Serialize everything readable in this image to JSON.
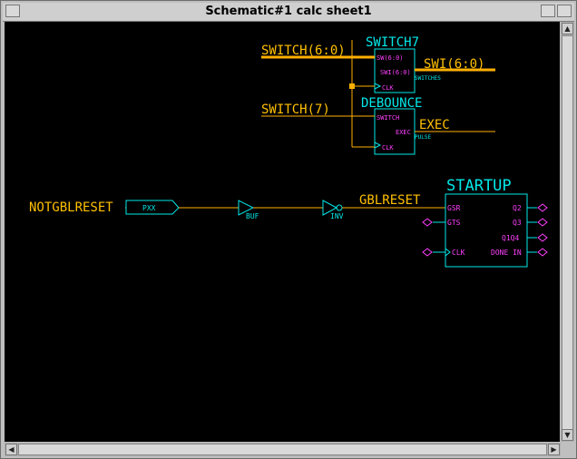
{
  "window": {
    "title": "Schematic#1 calc sheet1"
  },
  "nets": {
    "switch_bus": "SWITCH(6:0)",
    "switch7": "SWITCH(7)",
    "swi_bus": "SWI(6:0)",
    "exec": "EXEC",
    "notglbreset": "NOTGBLRESET",
    "glbreset": "GBLRESET"
  },
  "components": {
    "switch7": {
      "name": "SWITCH7",
      "pin_in": "SW(6:0)",
      "pin_out": "SWI(6:0)",
      "pin_clk": "CLK",
      "pin_sub": "SWITCHES"
    },
    "debounce": {
      "name": "DEBOUNCE",
      "pin_in": "SWITCH",
      "pin_out": "EXEC",
      "pin_clk": "CLK",
      "pin_sub": "PULSE"
    },
    "pad": {
      "label": "PXX"
    },
    "buf": {
      "label": "BUF"
    },
    "inv": {
      "label": "INV"
    },
    "startup": {
      "name": "STARTUP",
      "pins": {
        "gsr": "GSR",
        "gts": "GTS",
        "clk": "CLK",
        "q2": "Q2",
        "q3": "Q3",
        "q1q4": "Q1Q4",
        "done_in": "DONE IN"
      }
    }
  },
  "colors": {
    "wire": "#ffb000",
    "label": "#ffc000",
    "body": "#00e8e8",
    "pin": "#ff40ff",
    "bg": "#000000"
  }
}
